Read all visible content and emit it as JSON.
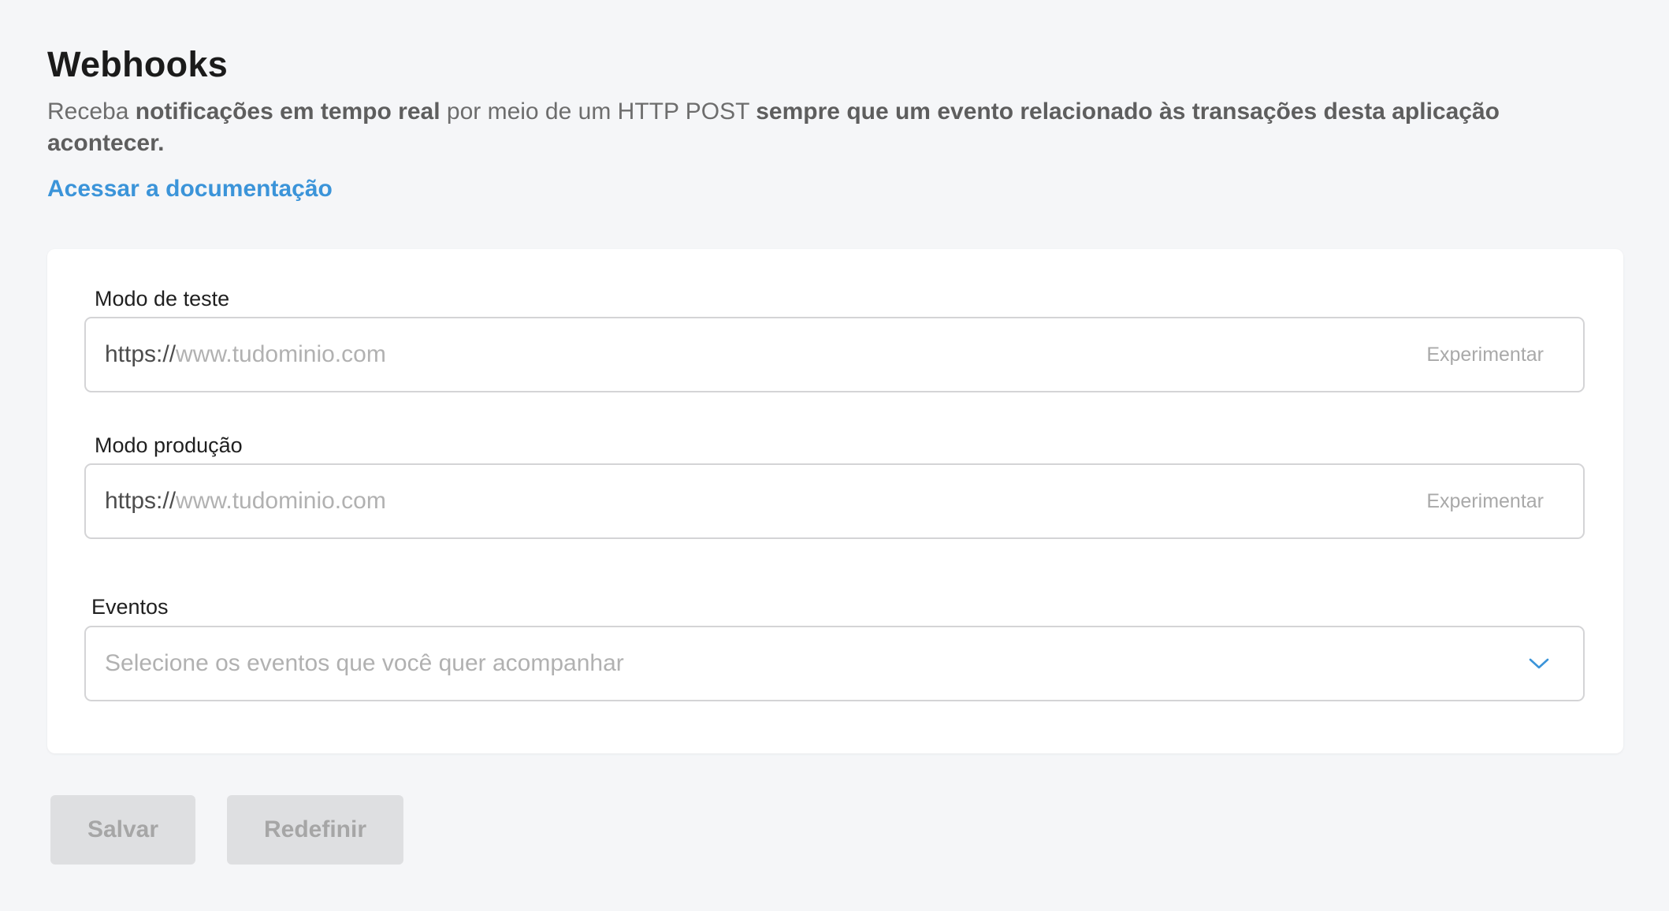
{
  "header": {
    "title": "Webhooks",
    "description": {
      "p1": "Receba ",
      "b1": "notificações em tempo real",
      "p2": " por meio de um HTTP POST ",
      "b2": "sempre que um evento relacionado às transações desta aplicação acontecer."
    },
    "doc_link": "Acessar a documentação"
  },
  "form": {
    "test_mode": {
      "label": "Modo de teste",
      "prefix": "https://",
      "placeholder": "www.tudominio.com",
      "value": "",
      "action": "Experimentar"
    },
    "production_mode": {
      "label": "Modo produção",
      "prefix": "https://",
      "placeholder": "www.tudominio.com",
      "value": "",
      "action": "Experimentar"
    },
    "events": {
      "label": "Eventos",
      "placeholder": "Selecione os eventos que você quer acompanhar"
    }
  },
  "actions": {
    "save": "Salvar",
    "reset": "Redefinir"
  },
  "colors": {
    "link": "#3b94d9",
    "chevron": "#3b94d9",
    "background": "#f5f6f8",
    "disabled_button": "#dedfe1"
  },
  "icons": {
    "events_dropdown": "chevron-down-icon"
  }
}
